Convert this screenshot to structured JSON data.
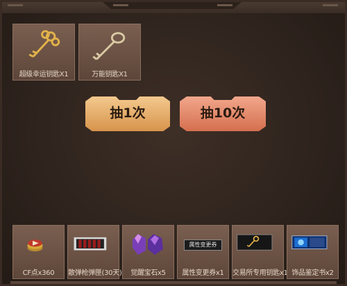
{
  "keys": [
    {
      "label": "超级幸运钥匙X1",
      "icon": "golden-ornate-key-icon"
    },
    {
      "label": "万能钥匙X1",
      "icon": "silver-key-icon"
    }
  ],
  "buttons": {
    "draw_once": "抽1次",
    "draw_ten": "抽10次"
  },
  "rewards": [
    {
      "label": "CF点x360",
      "icon": "cf-points-coin-icon"
    },
    {
      "label": "散弹枪弹匣(30天)",
      "icon": "shotgun-magazine-icon"
    },
    {
      "label": "觉醒宝石x5",
      "icon": "awakening-gem-icon"
    },
    {
      "label": "属性变更券x1",
      "icon": "attribute-ticket-icon",
      "art_text": "属性变更券"
    },
    {
      "label": "交易所专用钥匙x1",
      "icon": "exchange-key-icon"
    },
    {
      "label": "饰品鉴定书x2",
      "icon": "accessory-certificate-icon"
    }
  ],
  "colors": {
    "button_gold": "#e0a35c",
    "button_red": "#e0805f",
    "panel": "#2f241e"
  }
}
